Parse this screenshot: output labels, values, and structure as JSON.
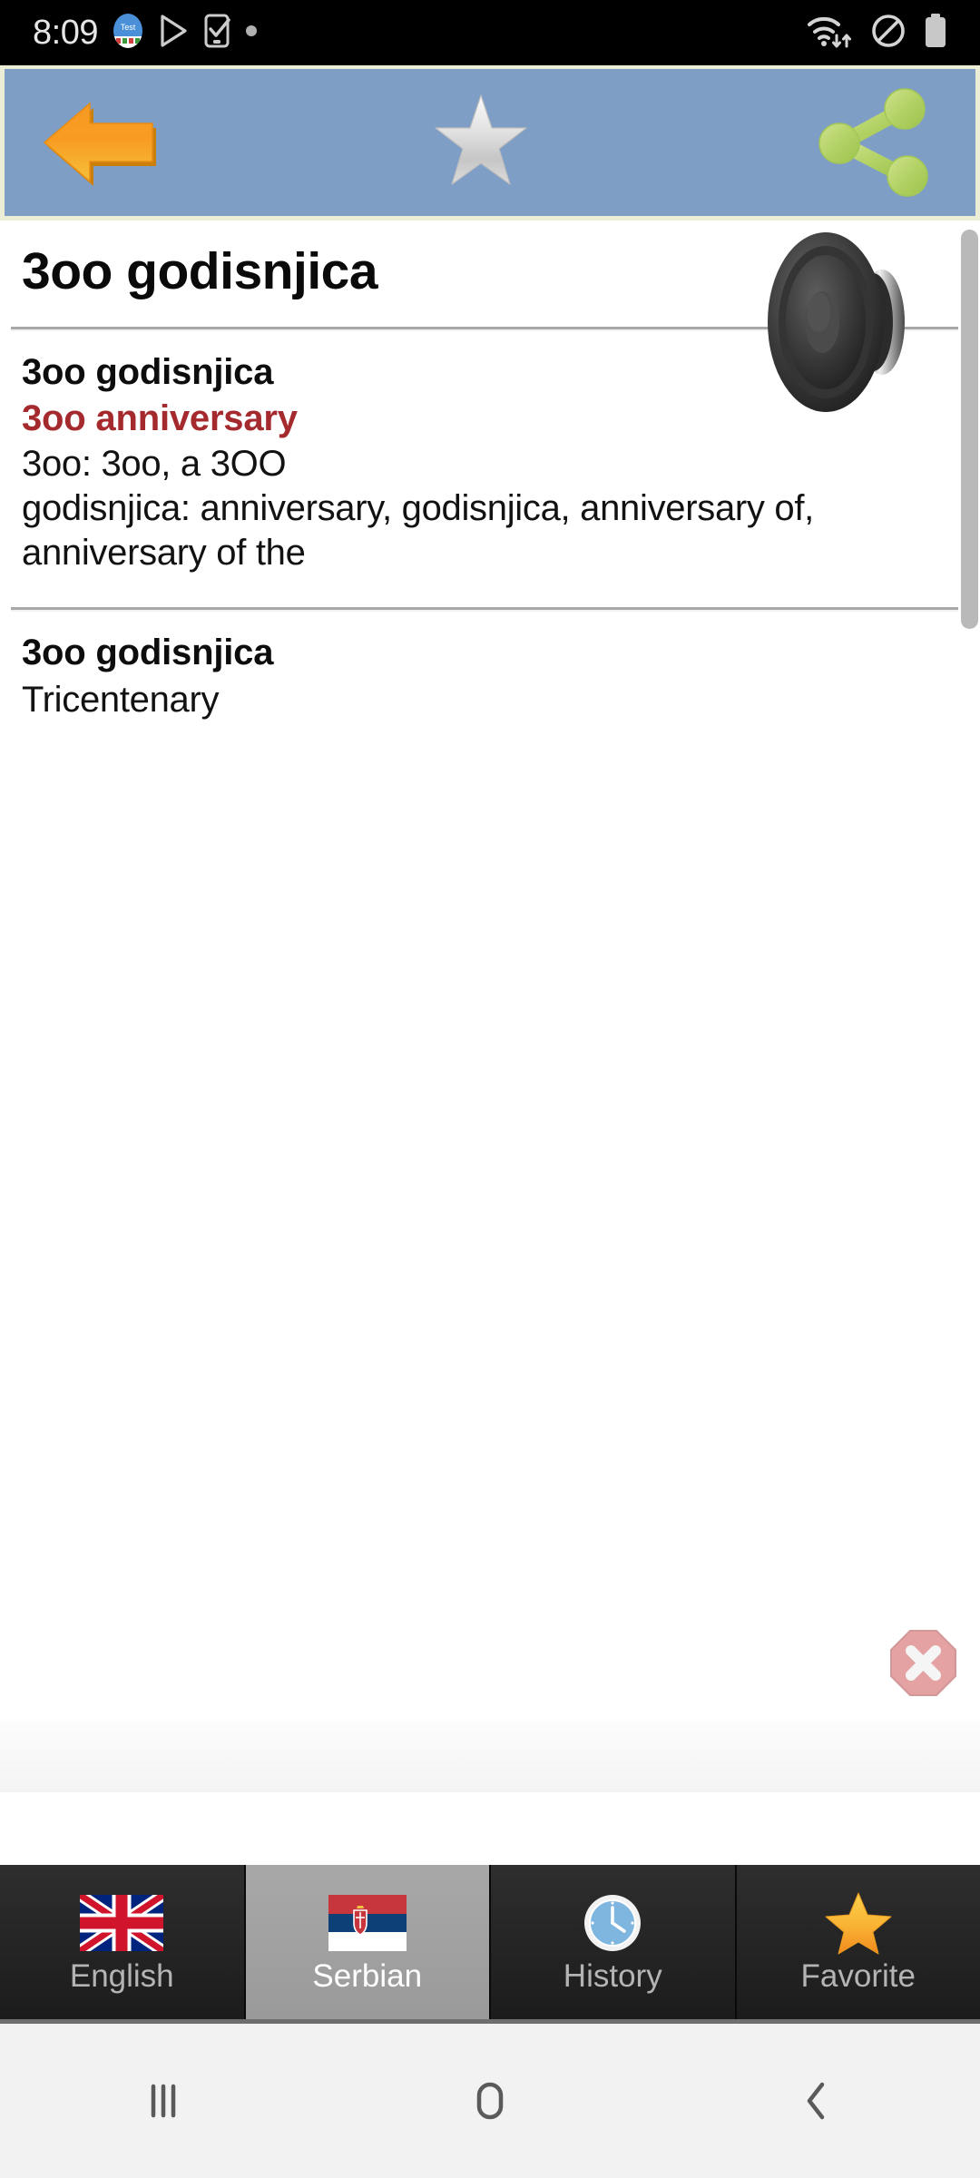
{
  "status_bar": {
    "time": "8:09",
    "left_icons": [
      "test-app-icon",
      "play-store-icon",
      "phone-check-icon",
      "dot-indicator-icon"
    ],
    "right_icons": [
      "wifi-transfer-icon",
      "do-not-disturb-icon",
      "battery-icon"
    ],
    "background": "#000000",
    "foreground": "#e6e6e6"
  },
  "toolbar": {
    "background": "#7f9ec6",
    "border_color": "#ecedd6",
    "back_icon": "back-arrow-icon",
    "back_label": "Back",
    "favorite_icon": "star-outline-icon",
    "favorite_label": "Add to favorites",
    "share_icon": "share-icon",
    "share_label": "Share"
  },
  "entry": {
    "headword": "3oo godisnjica",
    "speaker_icon": "speaker-icon",
    "speaker_label": "Pronounce",
    "sections": [
      {
        "term": "3oo godisnjica",
        "translation": "3oo anniversary",
        "translation_color": "#a52a2e",
        "details": [
          "3oo: 3oo, a 3OO",
          "godisnjica: anniversary, godisnjica, anniversary of, anniversary of the"
        ]
      },
      {
        "term": "3oo godisnjica",
        "translation": "Tricentenary"
      }
    ]
  },
  "ad": {
    "close_icon": "close-octagon-icon",
    "close_label": "Close ad"
  },
  "tabs": [
    {
      "label": "English",
      "icon": "uk-flag-icon",
      "active": false
    },
    {
      "label": "Serbian",
      "icon": "serbia-flag-icon",
      "active": true
    },
    {
      "label": "History",
      "icon": "clock-icon",
      "active": false
    },
    {
      "label": "Favorite",
      "icon": "star-filled-icon",
      "active": false
    }
  ],
  "nav_bar": {
    "recents_label": "Recents",
    "home_label": "Home",
    "back_label": "Back",
    "recents_icon": "recents-icon",
    "home_icon": "home-icon",
    "back_icon": "chevron-back-icon"
  }
}
